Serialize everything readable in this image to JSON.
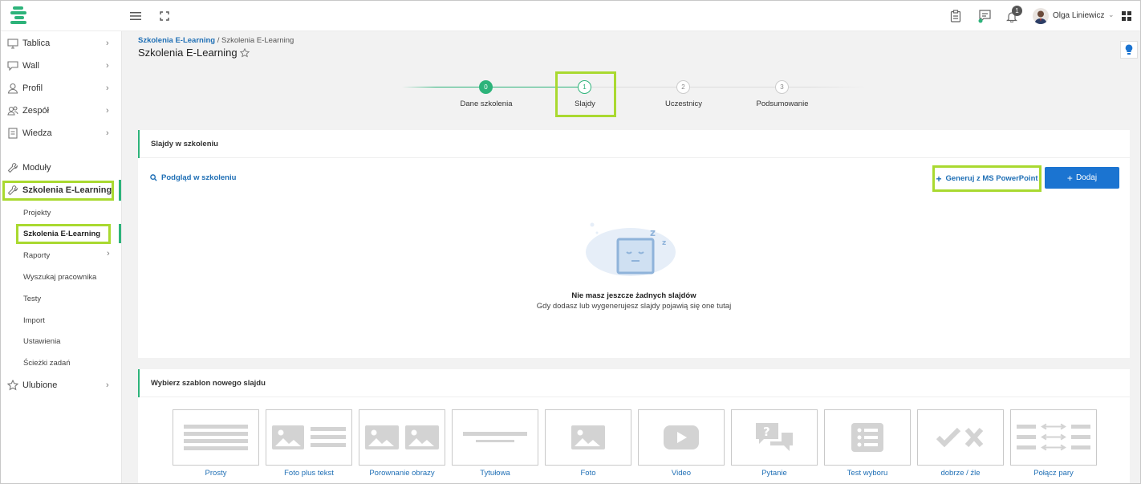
{
  "topbar": {
    "user_name": "Olga Liniewicz",
    "notification_count": "1"
  },
  "sidebar": {
    "items": [
      {
        "label": "Tablica"
      },
      {
        "label": "Wall"
      },
      {
        "label": "Profil"
      },
      {
        "label": "Zespół"
      },
      {
        "label": "Wiedza"
      },
      {
        "label": "Moduły"
      },
      {
        "label": "Szkolenia E-Learning"
      },
      {
        "label": "Ulubione"
      }
    ],
    "sub_items": [
      {
        "label": "Projekty"
      },
      {
        "label": "Szkolenia E-Learning"
      },
      {
        "label": "Raporty"
      },
      {
        "label": "Wyszukaj pracownika"
      },
      {
        "label": "Testy"
      },
      {
        "label": "Import"
      },
      {
        "label": "Ustawienia"
      },
      {
        "label": "Ścieżki zadań"
      }
    ]
  },
  "header": {
    "breadcrumb_link": "Szkolenia E-Learning",
    "breadcrumb_sep": " / ",
    "breadcrumb_current": "Szkolenia E-Learning",
    "title": "Szkolenia E-Learning"
  },
  "stepper": {
    "steps": [
      {
        "number": "0",
        "label": "Dane szkolenia"
      },
      {
        "number": "1",
        "label": "Slajdy"
      },
      {
        "number": "2",
        "label": "Uczestnicy"
      },
      {
        "number": "3",
        "label": "Podsumowanie"
      }
    ]
  },
  "slides_card": {
    "title": "Slajdy w szkoleniu",
    "preview_link": "Podgląd w szkoleniu",
    "generate_button": "Generuj z MS PowerPoint",
    "add_button": "Dodaj",
    "empty_title": "Nie masz jeszcze żadnych slajdów",
    "empty_subtitle": "Gdy dodasz lub wygenerujesz slajdy pojawią się one tutaj"
  },
  "templates_card": {
    "title": "Wybierz szablon nowego slajdu",
    "templates": [
      {
        "label": "Prosty"
      },
      {
        "label": "Foto plus tekst"
      },
      {
        "label": "Porownanie obrazy"
      },
      {
        "label": "Tytułowa"
      },
      {
        "label": "Foto"
      },
      {
        "label": "Video"
      },
      {
        "label": "Pytanie"
      },
      {
        "label": "Test wyboru"
      },
      {
        "label": "dobrze / źle"
      },
      {
        "label": "Połącz pary"
      }
    ]
  },
  "colors": {
    "accent_green": "#2db37a",
    "highlight_lime": "#a9d930",
    "link_blue": "#1f6fb5",
    "primary_button": "#1b74d1"
  }
}
